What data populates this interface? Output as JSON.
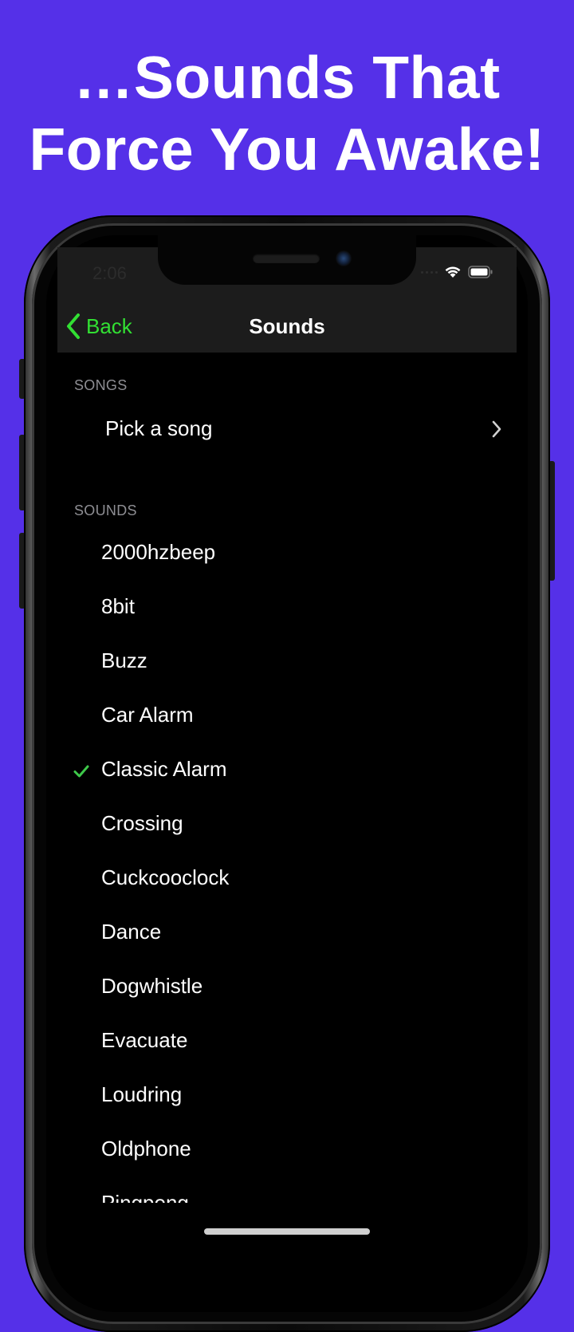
{
  "headline": {
    "line1": "…Sounds That",
    "line2": "Force You Awake!"
  },
  "status_bar": {
    "time": "2:06",
    "icons": [
      "signal-dots-icon",
      "wifi-icon",
      "battery-icon"
    ]
  },
  "nav": {
    "back_label": "Back",
    "title": "Sounds"
  },
  "songs_section": {
    "header": "SONGS",
    "pick_label": "Pick a song"
  },
  "sounds_section": {
    "header": "SOUNDS",
    "items": [
      {
        "label": "2000hzbeep",
        "selected": false
      },
      {
        "label": "8bit",
        "selected": false
      },
      {
        "label": "Buzz",
        "selected": false
      },
      {
        "label": "Car Alarm",
        "selected": false
      },
      {
        "label": "Classic Alarm",
        "selected": true
      },
      {
        "label": "Crossing",
        "selected": false
      },
      {
        "label": "Cuckcooclock",
        "selected": false
      },
      {
        "label": "Dance",
        "selected": false
      },
      {
        "label": "Dogwhistle",
        "selected": false
      },
      {
        "label": "Evacuate",
        "selected": false
      },
      {
        "label": "Loudring",
        "selected": false
      },
      {
        "label": "Oldphone",
        "selected": false
      },
      {
        "label": "Pingpong",
        "selected": false
      }
    ]
  },
  "colors": {
    "background": "#5530e8",
    "accent": "#32e033",
    "checkmark": "#3ec84a",
    "navbar": "#1c1c1c"
  }
}
